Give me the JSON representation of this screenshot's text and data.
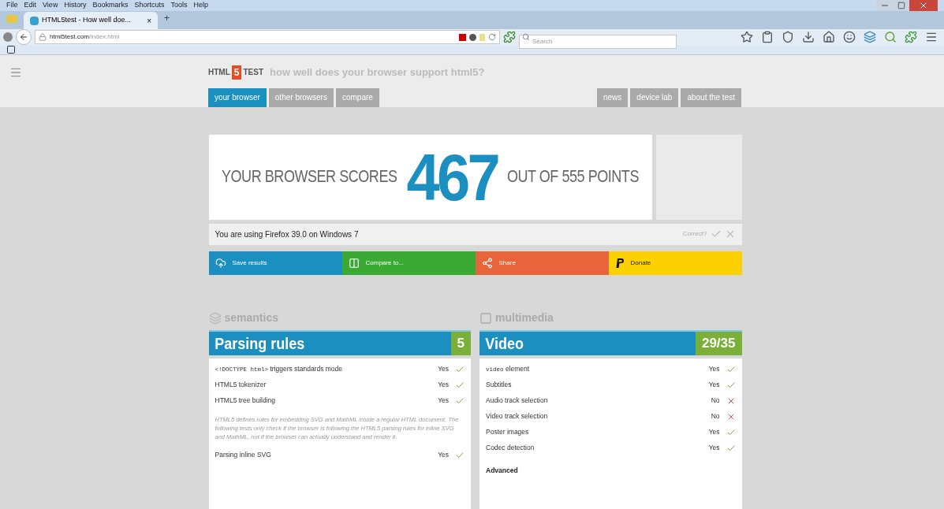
{
  "menu": [
    "File",
    "Edit",
    "View",
    "History",
    "Bookmarks",
    "Shortcuts",
    "Tools",
    "Help"
  ],
  "tab": {
    "title": "HTML5test - How well doe...",
    "close": "×",
    "new": "+",
    "selected": true
  },
  "address": {
    "host": "html5test.com",
    "path": "/index.html"
  },
  "search": {
    "placeholder": "Search"
  },
  "site": {
    "logo_left": "HTML",
    "logo_mark": "5",
    "logo_right": "TEST",
    "tagline": "how well does your browser support html5?"
  },
  "nav_left": [
    {
      "label": "your browser",
      "selected": true
    },
    {
      "label": "other browsers",
      "selected": false
    },
    {
      "label": "compare",
      "selected": false
    }
  ],
  "nav_right": [
    {
      "label": "news",
      "selected": false
    },
    {
      "label": "device lab",
      "selected": false
    },
    {
      "label": "about the test",
      "selected": false
    }
  ],
  "score": {
    "before": "YOUR BROWSER SCORES",
    "value": "467",
    "after": "OUT OF 555 POINTS"
  },
  "info": {
    "text": "You are using Firefox 39.0 on Windows 7",
    "correct": "Correct?"
  },
  "actions": [
    {
      "kind": "save",
      "label": "Save results",
      "color": "#1a8fc0"
    },
    {
      "kind": "compare",
      "label": "Compare to...",
      "color": "#3aaa35"
    },
    {
      "kind": "share",
      "label": "Share",
      "color": "#e8643a"
    },
    {
      "kind": "donate",
      "label": "Donate",
      "color": "#fdd000"
    }
  ],
  "sections": [
    {
      "kind": "semantics",
      "heading": "semantics",
      "title": "Parsing rules",
      "score": "5",
      "rows": [
        {
          "kind": "test",
          "code": "<!DOCTYPE html>",
          "label": " triggers standards mode",
          "result": "Yes",
          "passed": true
        },
        {
          "kind": "test",
          "label": "HTML5 tokenizer",
          "result": "Yes",
          "passed": true
        },
        {
          "kind": "test",
          "label": "HTML5 tree building",
          "result": "Yes",
          "passed": true
        },
        {
          "kind": "note",
          "label": "HTML5 defines rules for embedding SVG and MathML inside a regular HTML document. The following tests only check if the browser is following the HTML5 parsing rules for inline SVG and MathML, not if the browser can actually understand and render it."
        },
        {
          "kind": "test",
          "label": "Parsing inline SVG",
          "result": "Yes",
          "passed": true
        }
      ]
    },
    {
      "kind": "multimedia",
      "heading": "multimedia",
      "title": "Video",
      "score": "29/35",
      "rows": [
        {
          "kind": "test",
          "code": "video",
          "label": " element",
          "result": "Yes",
          "passed": true
        },
        {
          "kind": "test",
          "label": "Subtitles",
          "result": "Yes",
          "passed": true
        },
        {
          "kind": "test",
          "label": "Audio track selection",
          "result": "No",
          "passed": false
        },
        {
          "kind": "test",
          "label": "Video track selection",
          "result": "No",
          "passed": false
        },
        {
          "kind": "test",
          "label": "Poster images",
          "result": "Yes",
          "passed": true
        },
        {
          "kind": "test",
          "label": "Codec detection",
          "result": "Yes",
          "passed": true
        },
        {
          "kind": "subheading",
          "label": "Advanced"
        }
      ]
    }
  ]
}
